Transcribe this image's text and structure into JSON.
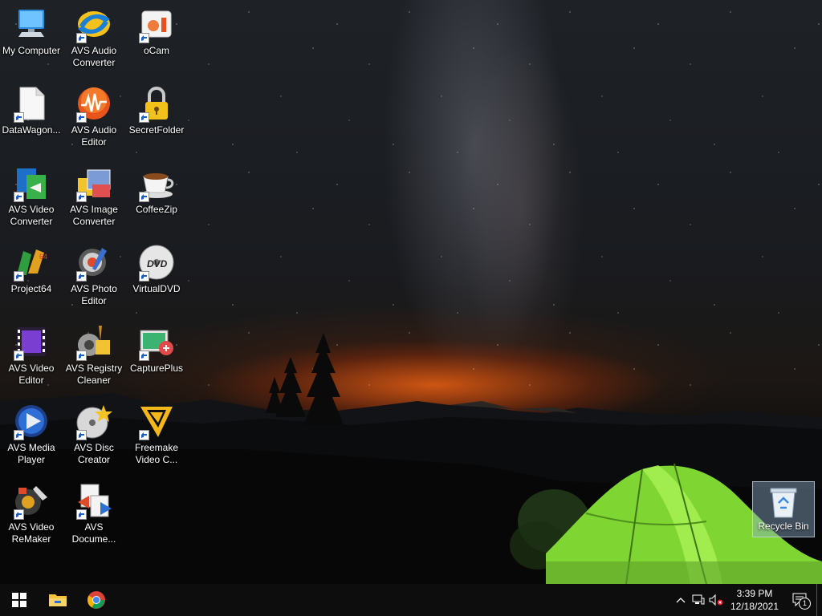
{
  "desktop": {
    "icons": [
      {
        "label": "My Computer",
        "icon": "computer-icon"
      },
      {
        "label": "AVS Audio Converter",
        "icon": "avs-audio-converter-icon"
      },
      {
        "label": "oCam",
        "icon": "ocam-icon"
      },
      {
        "label": "DataWagon...",
        "icon": "blank-file-icon"
      },
      {
        "label": "AVS Audio Editor",
        "icon": "avs-audio-editor-icon"
      },
      {
        "label": "SecretFolder",
        "icon": "padlock-icon"
      },
      {
        "label": "AVS Video Converter",
        "icon": "avs-video-converter-icon"
      },
      {
        "label": "AVS Image Converter",
        "icon": "avs-image-converter-icon"
      },
      {
        "label": "CoffeeZip",
        "icon": "coffee-cup-icon"
      },
      {
        "label": "Project64",
        "icon": "project64-icon"
      },
      {
        "label": "AVS Photo Editor",
        "icon": "avs-photo-editor-icon"
      },
      {
        "label": "VirtualDVD",
        "icon": "dvd-disc-icon"
      },
      {
        "label": "AVS Video Editor",
        "icon": "film-strip-icon"
      },
      {
        "label": "AVS Registry Cleaner",
        "icon": "avs-registry-cleaner-icon"
      },
      {
        "label": "CapturePlus",
        "icon": "captureplus-icon"
      },
      {
        "label": "AVS Media Player",
        "icon": "media-player-icon"
      },
      {
        "label": "AVS Disc Creator",
        "icon": "disc-creator-icon"
      },
      {
        "label": "Freemake Video C...",
        "icon": "freemake-icon"
      },
      {
        "label": "AVS Video ReMaker",
        "icon": "avs-video-remaker-icon"
      },
      {
        "label": "AVS Docume...",
        "icon": "avs-document-converter-icon"
      }
    ],
    "recycle_bin": {
      "label": "Recycle Bin",
      "icon": "recycle-bin-icon"
    }
  },
  "taskbar": {
    "pinned": [
      {
        "name": "Start",
        "icon": "windows-start-icon"
      },
      {
        "name": "File Explorer",
        "icon": "file-explorer-icon"
      },
      {
        "name": "Google Chrome",
        "icon": "chrome-icon"
      }
    ],
    "tray": {
      "icons": [
        "chevron-up-icon",
        "network-icon",
        "volume-muted-icon"
      ],
      "time": "3:39 PM",
      "date": "12/18/2021",
      "notification_count": "1"
    }
  },
  "colors": {
    "taskbar": "#0d0d0e",
    "tent_green": "#8ee83a",
    "horizon_glow": "#e0651c",
    "selection": "#8caac8"
  }
}
